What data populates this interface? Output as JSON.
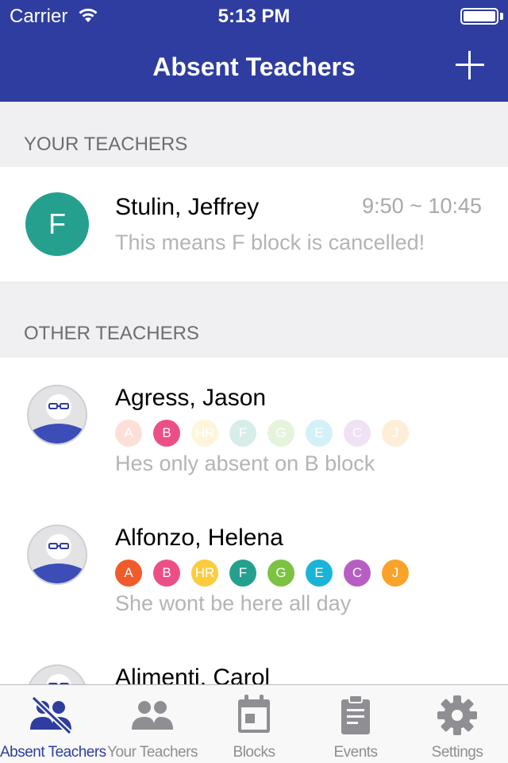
{
  "status_bar": {
    "carrier": "Carrier",
    "time": "5:13 PM"
  },
  "nav": {
    "title": "Absent Teachers",
    "add_icon": "plus-icon"
  },
  "sections": {
    "yours": "YOUR TEACHERS",
    "others": "OTHER TEACHERS"
  },
  "your_teachers": [
    {
      "initial": "F",
      "name": "Stulin, Jeffrey",
      "time": "9:50 ~ 10:45",
      "note": "This means F block is cancelled!",
      "avatar_color": "#26a08e"
    }
  ],
  "block_colors": {
    "A": "#f15a2b",
    "B": "#ec4f87",
    "HR": "#fbcc3e",
    "F": "#26a08e",
    "G": "#7cc243",
    "E": "#1ab5d6",
    "C": "#b65ec4",
    "J": "#f9a32b"
  },
  "other_teachers": [
    {
      "name": "Agress, Jason",
      "note": "Hes only absent on B block",
      "blocks": [
        {
          "label": "A",
          "absent": false
        },
        {
          "label": "B",
          "absent": true
        },
        {
          "label": "HR",
          "absent": false
        },
        {
          "label": "F",
          "absent": false
        },
        {
          "label": "G",
          "absent": false
        },
        {
          "label": "E",
          "absent": false
        },
        {
          "label": "C",
          "absent": false
        },
        {
          "label": "J",
          "absent": false
        }
      ]
    },
    {
      "name": "Alfonzo, Helena",
      "note": "She wont be here all day",
      "blocks": [
        {
          "label": "A",
          "absent": true
        },
        {
          "label": "B",
          "absent": true
        },
        {
          "label": "HR",
          "absent": true
        },
        {
          "label": "F",
          "absent": true
        },
        {
          "label": "G",
          "absent": true
        },
        {
          "label": "E",
          "absent": true
        },
        {
          "label": "C",
          "absent": true
        },
        {
          "label": "J",
          "absent": true
        }
      ]
    },
    {
      "name": "Alimenti, Carol",
      "note": "",
      "blocks": []
    }
  ],
  "tabs": [
    {
      "label": "Absent Teachers",
      "icon": "absent-teachers-icon",
      "active": true
    },
    {
      "label": "Your Teachers",
      "icon": "your-teachers-icon",
      "active": false
    },
    {
      "label": "Blocks",
      "icon": "calendar-icon",
      "active": false
    },
    {
      "label": "Events",
      "icon": "clipboard-icon",
      "active": false
    },
    {
      "label": "Settings",
      "icon": "gear-icon",
      "active": false
    }
  ],
  "colors": {
    "brand": "#2e3d9f",
    "tab_inactive": "#8e8e93"
  }
}
